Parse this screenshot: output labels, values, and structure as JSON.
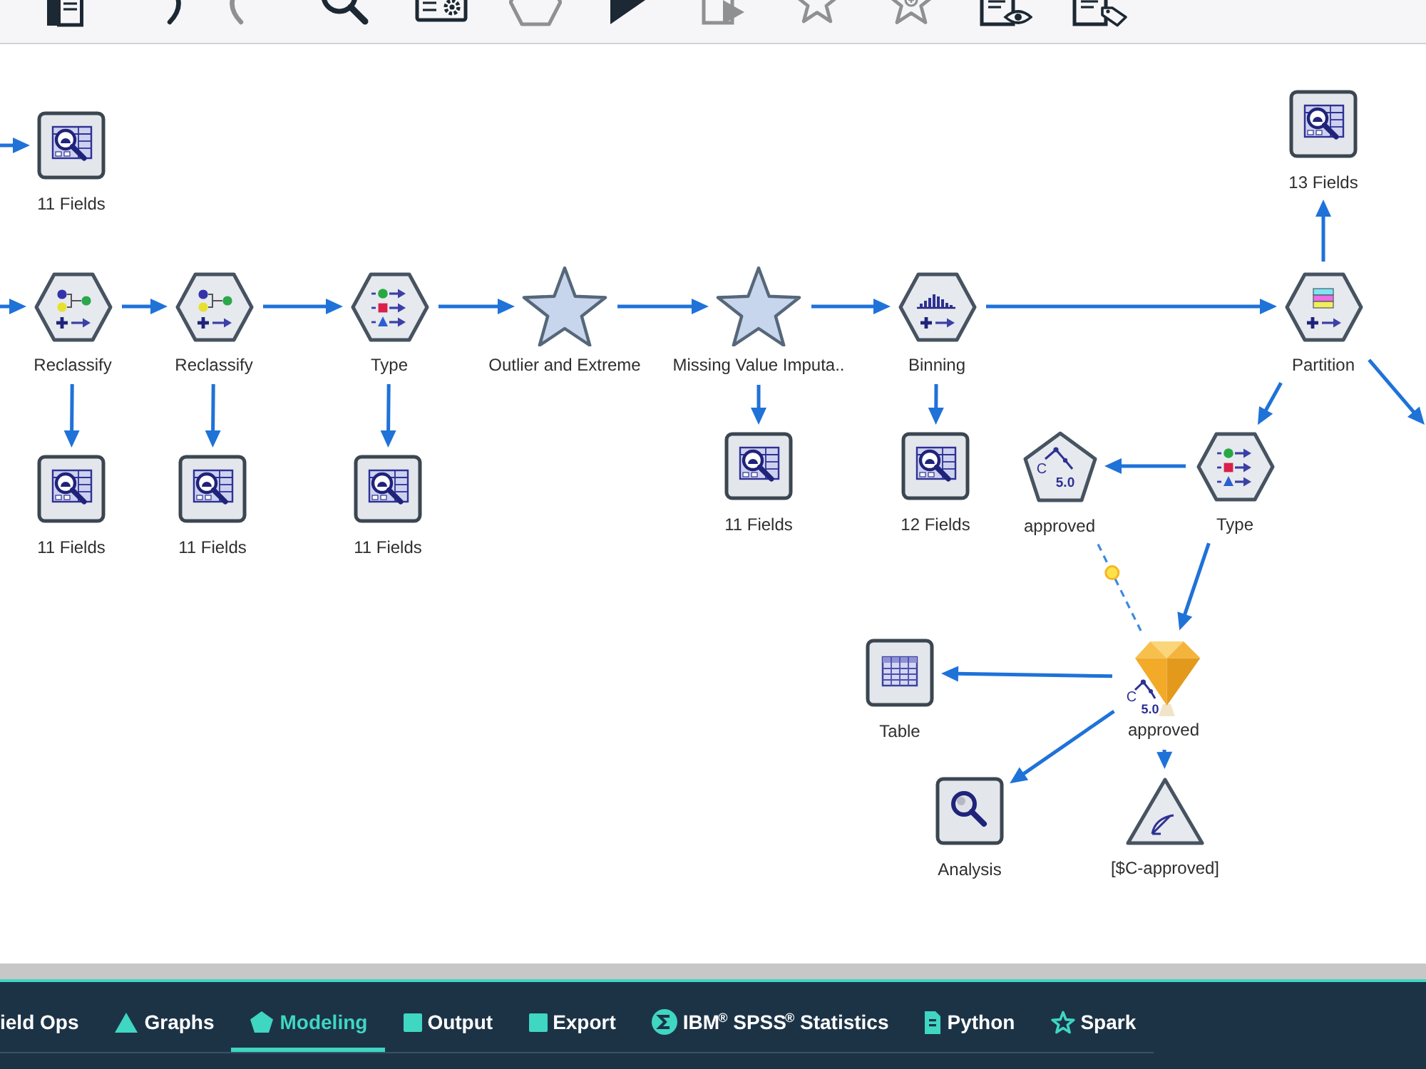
{
  "toolbar": {
    "buttons": [
      {
        "kind": "documents",
        "disabled": false
      },
      {
        "kind": "undo",
        "disabled": false
      },
      {
        "kind": "redo",
        "disabled": true
      },
      {
        "kind": "search",
        "disabled": false
      },
      {
        "kind": "screen",
        "disabled": false
      },
      {
        "kind": "hexagon",
        "disabled": true
      },
      {
        "kind": "play",
        "disabled": false
      },
      {
        "kind": "docplay",
        "disabled": true
      },
      {
        "kind": "star",
        "disabled": true
      },
      {
        "kind": "starplus",
        "disabled": true
      },
      {
        "kind": "doceye",
        "disabled": false
      },
      {
        "kind": "doctag",
        "disabled": false
      }
    ]
  },
  "canvas": {
    "nodes": [
      {
        "kind": "audit",
        "label": "11 Fields"
      },
      {
        "kind": "audit",
        "label": "13 Fields"
      },
      {
        "kind": "reclassify",
        "label": "Reclassify"
      },
      {
        "kind": "reclassify",
        "label": "Reclassify"
      },
      {
        "kind": "type",
        "label": "Type"
      },
      {
        "kind": "star",
        "label": "Outlier and Extreme"
      },
      {
        "kind": "star",
        "label": "Missing Value Imputa.."
      },
      {
        "kind": "binning",
        "label": "Binning"
      },
      {
        "kind": "partition",
        "label": "Partition"
      },
      {
        "kind": "audit",
        "label": "11 Fields"
      },
      {
        "kind": "audit",
        "label": "11 Fields"
      },
      {
        "kind": "audit",
        "label": "11 Fields"
      },
      {
        "kind": "audit",
        "label": "11 Fields"
      },
      {
        "kind": "audit",
        "label": "12 Fields"
      },
      {
        "kind": "c50",
        "label": "approved",
        "icon_letter": "C",
        "icon_version": "5.0"
      },
      {
        "kind": "type",
        "label": "Type"
      },
      {
        "kind": "table",
        "label": "Table"
      },
      {
        "kind": "nugget",
        "label": "approved",
        "icon_letter": "C",
        "icon_version": "5.0"
      },
      {
        "kind": "analysis",
        "label": "Analysis"
      },
      {
        "kind": "evaluation",
        "label": "[$C-approved]"
      }
    ],
    "links": [
      {
        "kind": "flow"
      },
      {
        "kind": "flow"
      },
      {
        "kind": "flow"
      },
      {
        "kind": "flow"
      },
      {
        "kind": "flow"
      },
      {
        "kind": "flow"
      },
      {
        "kind": "flow"
      },
      {
        "kind": "flow"
      },
      {
        "kind": "flow"
      },
      {
        "kind": "flow"
      },
      {
        "kind": "flow"
      },
      {
        "kind": "flow"
      },
      {
        "kind": "flow"
      },
      {
        "kind": "flow"
      },
      {
        "kind": "flow"
      },
      {
        "kind": "flow"
      },
      {
        "kind": "flow"
      },
      {
        "kind": "model"
      },
      {
        "kind": "flow"
      },
      {
        "kind": "flow"
      },
      {
        "kind": "flow"
      },
      {
        "kind": "flow"
      }
    ]
  },
  "palette_tabs": [
    {
      "label": "ield Ops",
      "kind": "none",
      "selected": false
    },
    {
      "label": "Graphs",
      "kind": "triangle",
      "selected": false
    },
    {
      "label": "Modeling",
      "kind": "pentagon",
      "selected": true
    },
    {
      "label": "Output",
      "kind": "square",
      "selected": false
    },
    {
      "label": "Export",
      "kind": "square",
      "selected": false
    },
    {
      "label": "IBM$^{®}$ SPSS$^{®}$ Statistics",
      "kind": "sigma",
      "selected": false
    },
    {
      "label": "Python",
      "kind": "document",
      "selected": false
    },
    {
      "label": "Spark",
      "kind": "star",
      "selected": false
    }
  ]
}
